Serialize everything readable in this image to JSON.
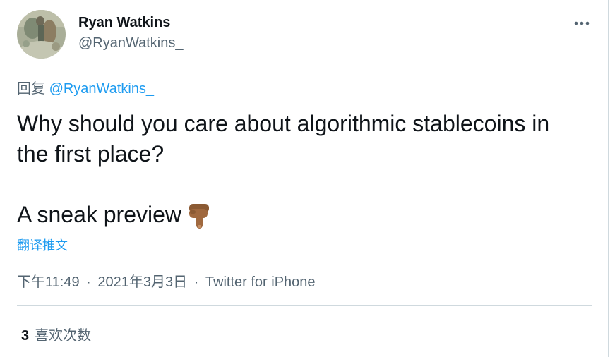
{
  "author": {
    "name": "Ryan Watkins",
    "handle": "@RyanWatkins_"
  },
  "reply": {
    "prefix": "回复",
    "handle": "@RyanWatkins_"
  },
  "tweet": {
    "line1": "Why should you care about algorithmic stablecoins in",
    "line2": "the first place?",
    "line3": "A sneak preview",
    "emoji_icon": "pointing-down-hand-icon"
  },
  "translate_label": "翻译推文",
  "meta": {
    "time": "下午11:49",
    "separator": "·",
    "date": "2021年3月3日",
    "source": "Twitter for iPhone"
  },
  "stats": {
    "likes_count": "3",
    "likes_label": "喜欢次数"
  },
  "colors": {
    "link_blue": "#1d9bf0",
    "secondary_text": "#536471",
    "divider": "#cfd9de"
  }
}
